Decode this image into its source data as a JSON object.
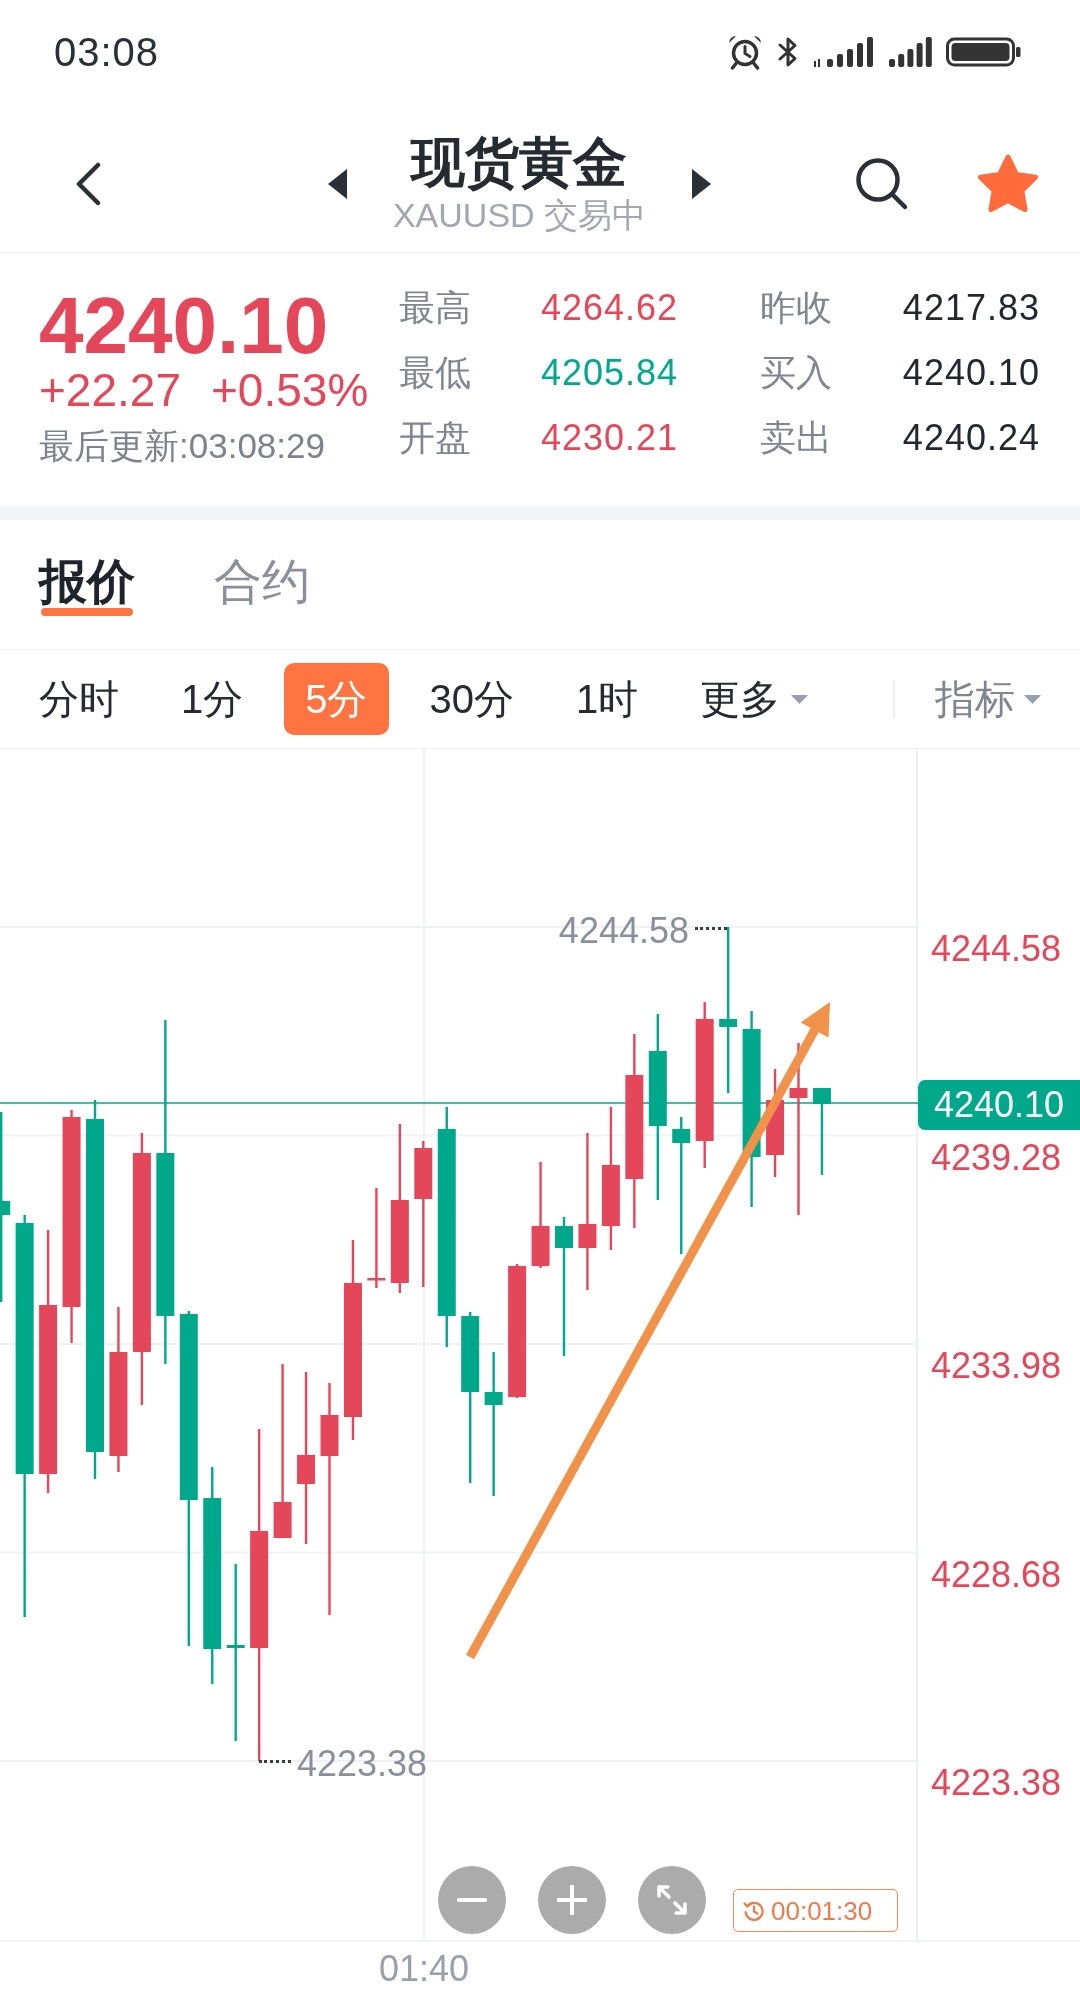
{
  "status_bar": {
    "time": "03:08"
  },
  "header": {
    "title": "现货黄金",
    "subtitle": "XAUUSD 交易中",
    "favorite": true
  },
  "quote": {
    "price": "4240.10",
    "change": "+22.27",
    "change_percent": "+0.53%",
    "updated": "最后更新:03:08:29",
    "stats": [
      {
        "label": "最高",
        "value": "4264.62",
        "color": "#e5475a"
      },
      {
        "label": "昨收",
        "value": "4217.83",
        "color": "#23272f"
      },
      {
        "label": "最低",
        "value": "4205.84",
        "color": "#00a88b"
      },
      {
        "label": "买入",
        "value": "4240.10",
        "color": "#23272f"
      },
      {
        "label": "开盘",
        "value": "4230.21",
        "color": "#e5475a"
      },
      {
        "label": "卖出",
        "value": "4240.24",
        "color": "#23272f"
      }
    ]
  },
  "tabs": [
    {
      "label": "报价",
      "selected": true
    },
    {
      "label": "合约",
      "selected": false
    }
  ],
  "periods": [
    {
      "label": "分时",
      "kind": "period",
      "selected": false
    },
    {
      "label": "1分",
      "kind": "period",
      "selected": false
    },
    {
      "label": "5分",
      "kind": "period",
      "selected": true
    },
    {
      "label": "30分",
      "kind": "period",
      "selected": false
    },
    {
      "label": "1时",
      "kind": "period",
      "selected": false
    },
    {
      "label": "更多",
      "kind": "dropdown",
      "selected": false
    }
  ],
  "indicator_menu": {
    "label": "指标"
  },
  "chart": {
    "price_axis": [
      "4244.58",
      "4239.28",
      "4233.98",
      "4228.68",
      "4223.38"
    ],
    "high_label": "4244.58",
    "low_label": "4223.38",
    "current_price": "4240.10",
    "countdown": "00:01:30",
    "time_axis": [
      "01:40"
    ]
  }
}
